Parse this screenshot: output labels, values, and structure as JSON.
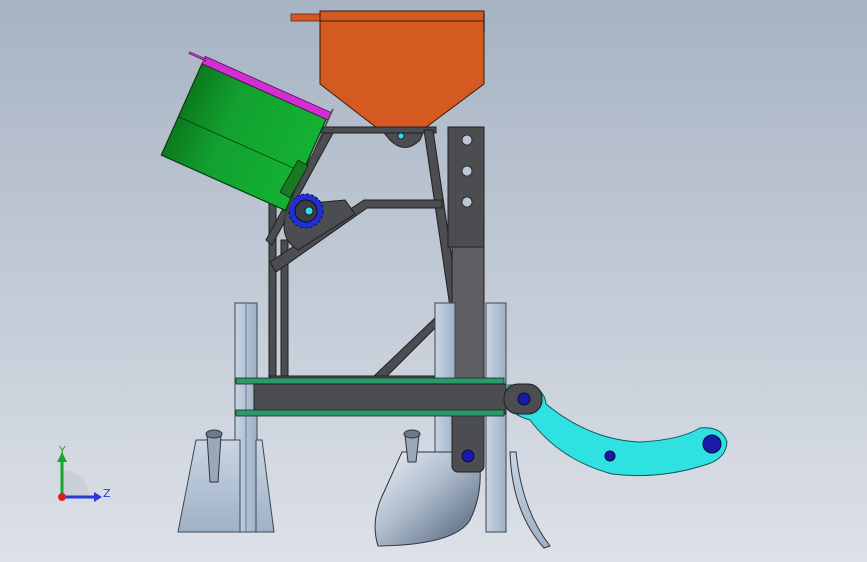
{
  "triad": {
    "y_label": "Y",
    "z_label": "Z"
  },
  "colors": {
    "background_top": "#a7b3c3",
    "background_bottom": "#dde1e8",
    "hopper": "#d55a22",
    "drum": "#12a12f",
    "drum_lid": "#d22fd2",
    "frame": "#4b4d50",
    "post": "#b9c7d8",
    "arm": "#2fe1e1",
    "pivot": "#1a1aa8",
    "sprocket": "#1f2fd8",
    "axis_y": "#1aa52a",
    "axis_z": "#2a3ad8",
    "axis_origin": "#d82020"
  }
}
